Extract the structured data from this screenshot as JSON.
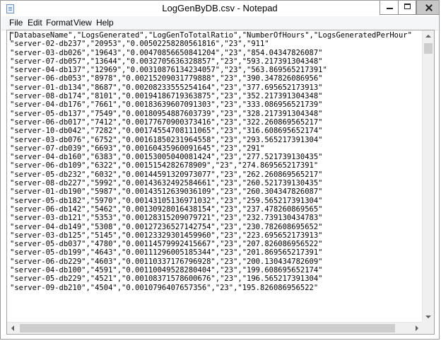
{
  "window": {
    "title": "LogGenByDB.csv - Notepad",
    "icons": {
      "app": "notepad-icon",
      "minimize": "minimize-icon",
      "maximize": "maximize-icon",
      "close": "close-icon"
    }
  },
  "menu": {
    "file": "File",
    "edit": "Edit",
    "format": "Format",
    "view": "View",
    "help": "Help"
  },
  "document": {
    "lines": [
      "\"DatabaseName\",\"LogsGenerated\",\"LogGenToTotalRatio\",\"NumberOfHours\",\"LogsGeneratedPerHour\"",
      "\"server-02-db237\",\"20953\",\"0.00502258280561816\",\"23\",\"911\"",
      "\"server-03-db026\",\"19643\",\"0.00470856650841204\",\"23\",\"854.04347826087\"",
      "\"server-07-db057\",\"13644\",\"0.0032705636328857\",\"23\",\"593.217391304348\"",
      "\"server-04-db137\",\"12969\",\"0.00310876134234057\",\"23\",\"563.869565217391\"",
      "\"server-06-db053\",\"8978\",\"0.00215209031779888\",\"23\",\"390.347826086956\"",
      "\"server-01-db134\",\"8687\",\"0.00208233555254164\",\"23\",\"377.695652173913\"",
      "\"server-08-db174\",\"8101\",\"0.00194186719363875\",\"23\",\"352.217391304348\"",
      "\"server-04-db176\",\"7661\",\"0.00183639607091303\",\"23\",\"333.086956521739\"",
      "\"server-05-db137\",\"7549\",\"0.00180954887603739\",\"23\",\"328.217391304348\"",
      "\"server-06-db017\",\"7412\",\"0.00177670900373416\",\"23\",\"322.260869565217\"",
      "\"server-10-db042\",\"7282\",\"0.00174554708111065\",\"23\",\"316.608695652174\"",
      "\"server-03-db076\",\"6752\",\"0.00161850231964558\",\"23\",\"293.565217391304\"",
      "\"server-07-db039\",\"6693\",\"0.00160435960091645\",\"23\",\"291\"",
      "\"server-04-db160\",\"6383\",\"0.00153005040081424\",\"23\",\"277.521739130435\"",
      "\"server-06-db109\",\"6322\",\"0.0015154282678909\",\"23\",\"274.869565217391\"",
      "\"server-05-db232\",\"6032\",\"0.00144591320973077\",\"23\",\"262.260869565217\"",
      "\"server-08-db227\",\"5992\",\"0.00143632492584661\",\"23\",\"260.521739130435\"",
      "\"server-01-db190\",\"5987\",\"0.00143512639036109\",\"23\",\"260.304347826087\"",
      "\"server-05-db182\",\"5970\",\"0.00143105136971032\",\"23\",\"259.565217391304\"",
      "\"server-06-db142\",\"5462\",\"0.00130928016438154\",\"23\",\"237.478260869565\"",
      "\"server-03-db121\",\"5353\",\"0.00128315209079721\",\"23\",\"232.739130434783\"",
      "\"server-04-db149\",\"5308\",\"0.00127236527142754\",\"23\",\"230.782608695652\"",
      "\"server-03-db125\",\"5145\",\"0.00123329301459960\",\"23\",\"223.695652173913\"",
      "\"server-05-db037\",\"4780\",\"0.00114579992415667\",\"23\",\"207.826086956522\"",
      "\"server-05-db199\",\"4643\",\"0.00111296005185344\",\"23\",\"201.869565217391\"",
      "\"server-06-db229\",\"4603\",\"0.00110337176796928\",\"23\",\"200.130434782609\"",
      "\"server-04-db100\",\"4591\",\"0.00110049528280404\",\"23\",\"199.608695652174\"",
      "\"server-05-db229\",\"4521\",\"0.00108371578600676\",\"23\",\"196.565217391304\"",
      "\"server-09-db210\",\"4504\",\"0.0010796407657356\",\"23\",\"195.826086956522\""
    ]
  }
}
